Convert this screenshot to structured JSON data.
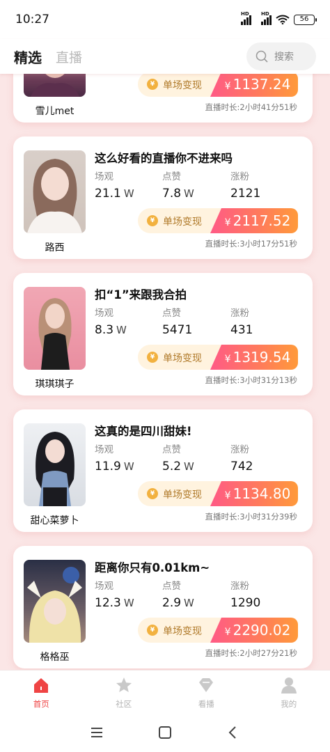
{
  "status_bar": {
    "time": "10:27",
    "signal_1": "HD",
    "signal_2": "HD",
    "battery": "56"
  },
  "header": {
    "tab_active": "精选",
    "tab_inactive": "直播",
    "search_placeholder": "搜索"
  },
  "labels": {
    "views": "场观",
    "likes": "点赞",
    "fans": "涨粉",
    "earn": "单场变现",
    "yen": "¥",
    "coin": "¥"
  },
  "cards": [
    {
      "host": "雪儿met",
      "title": "",
      "views": "",
      "views_unit": "",
      "likes": "",
      "likes_unit": "",
      "fans": "",
      "amount": "1137.24",
      "duration": "直播时长:2小时41分51秒"
    },
    {
      "host": "路西",
      "title": "这么好看的直播你不进来吗",
      "views": "21.1",
      "views_unit": "W",
      "likes": "7.8",
      "likes_unit": "W",
      "fans": "2121",
      "amount": "2117.52",
      "duration": "直播时长:3小时17分51秒"
    },
    {
      "host": "琪琪琪子",
      "title": "扣“1”来跟我合拍",
      "views": "8.3",
      "views_unit": "W",
      "likes": "5471",
      "likes_unit": "",
      "fans": "431",
      "amount": "1319.54",
      "duration": "直播时长:3小时31分13秒"
    },
    {
      "host": "甜心菜萝卜",
      "title": "这真的是四川甜妹!",
      "views": "11.9",
      "views_unit": "W",
      "likes": "5.2",
      "likes_unit": "W",
      "fans": "742",
      "amount": "1134.80",
      "duration": "直播时长:3小时31分39秒"
    },
    {
      "host": "格格巫",
      "title": "距离你只有0.01km~",
      "views": "12.3",
      "views_unit": "W",
      "likes": "2.9",
      "likes_unit": "W",
      "fans": "1290",
      "amount": "2290.02",
      "duration": "直播时长:2小时27分21秒"
    }
  ],
  "bottom_nav": [
    {
      "label": "首页",
      "icon": "home-icon",
      "active": true
    },
    {
      "label": "社区",
      "icon": "star-icon",
      "active": false
    },
    {
      "label": "看播",
      "icon": "diamond-icon",
      "active": false
    },
    {
      "label": "我的",
      "icon": "person-icon",
      "active": false
    }
  ],
  "colors": {
    "accent": "#ef4444",
    "earn_gradient_start": "#ff5a86",
    "earn_gradient_end": "#ff9a3a",
    "page_bg": "#fbe6e6"
  }
}
